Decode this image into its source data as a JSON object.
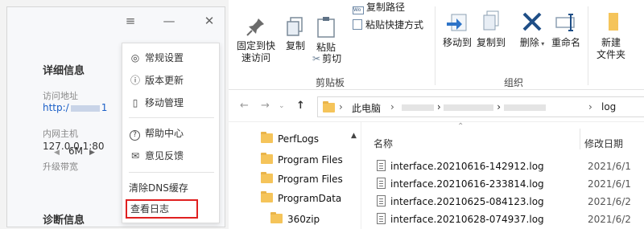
{
  "app": {
    "sections": {
      "details_title": "详细信息",
      "diagnostics_title": "诊断信息"
    },
    "fields": {
      "access_label": "访问地址",
      "access_value_prefix": "http:/",
      "access_value_suffix": "1",
      "intranet_label": "内网主机",
      "intranet_value": "127.0.0.1:80",
      "bandwidth_label": "升级带宽",
      "bandwidth_value": "6M"
    },
    "window_controls": {
      "menu": "≡",
      "minimize": "—",
      "close": "✕"
    }
  },
  "menu": {
    "items": [
      {
        "icon": "◎",
        "label": "常规设置"
      },
      {
        "icon": "ⓘ",
        "label": "版本更新"
      },
      {
        "icon": "▯",
        "label": "移动管理"
      },
      {
        "icon": "?",
        "label": "帮助中心"
      },
      {
        "icon": "✉",
        "label": "意见反馈"
      },
      {
        "icon": "",
        "label": "清除DNS缓存"
      },
      {
        "icon": "",
        "label": "查看日志"
      }
    ]
  },
  "ribbon": {
    "pin_label_1": "固定到快",
    "pin_label_2": "速访问",
    "copy": "复制",
    "paste": "粘贴",
    "copy_path": "复制路径",
    "paste_shortcut": "粘贴快捷方式",
    "cut": "剪切",
    "group_clipboard": "剪贴板",
    "move_to": "移动到",
    "copy_to": "复制到",
    "delete": "删除",
    "rename": "重命名",
    "new_folder_1": "新建",
    "new_folder_2": "文件夹",
    "group_organize": "组织"
  },
  "address": {
    "this_pc": "此电脑",
    "last": "log"
  },
  "tree": [
    "PerfLogs",
    "Program Files",
    "Program Files",
    "ProgramData",
    "360zip"
  ],
  "files": {
    "col_name": "名称",
    "col_modified": "修改日期",
    "rows": [
      {
        "name": "interface.20210616-142912.log",
        "date": "2021/6/1"
      },
      {
        "name": "interface.20210616-233814.log",
        "date": "2021/6/1"
      },
      {
        "name": "interface.20210625-084123.log",
        "date": "2021/6/2"
      },
      {
        "name": "interface.20210628-074937.log",
        "date": "2021/6/2"
      }
    ]
  },
  "colors": {
    "highlight_border": "#e02020",
    "link": "#1a5fc7",
    "folder": "#f5c45a"
  }
}
